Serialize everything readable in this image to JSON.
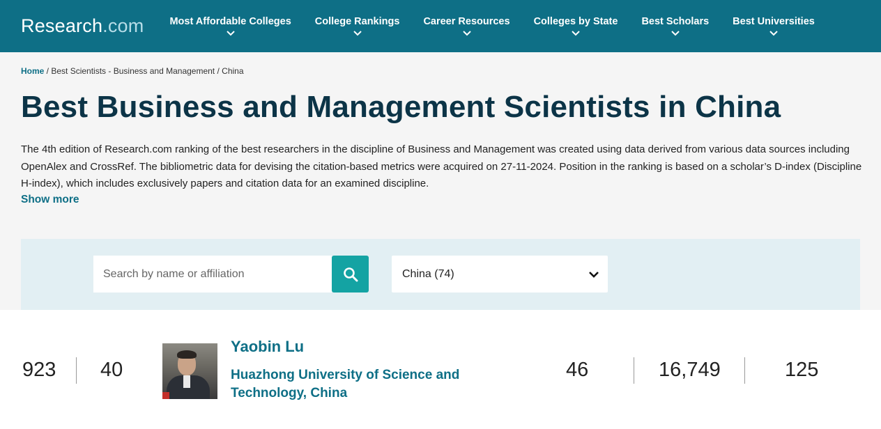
{
  "header": {
    "logo_main": "Research",
    "logo_suffix": ".com",
    "nav": [
      {
        "label": "Most Affordable Colleges"
      },
      {
        "label": "College Rankings"
      },
      {
        "label": "Career Resources"
      },
      {
        "label": "Colleges by State"
      },
      {
        "label": "Best Scholars"
      },
      {
        "label": "Best Universities"
      }
    ]
  },
  "breadcrumb": {
    "home": "Home",
    "sep1": " / ",
    "item1": "Best Scientists - Business and Management",
    "sep2": "  / ",
    "item2": "China"
  },
  "page": {
    "title": "Best Business and Management Scientists in China",
    "description": "The 4th edition of Research.com ranking of the best researchers in the discipline of Business and Management was created using data derived from various data sources including OpenAlex and CrossRef. The bibliometric data for devising the citation-based metrics were acquired on 27-11-2024. Position in the ranking is based on a scholar’s D-index (Discipline H-index), which includes exclusively papers and citation data for an examined discipline.",
    "show_more": "Show more"
  },
  "filters": {
    "search_placeholder": "Search by name or affiliation",
    "search_value": "",
    "country_selected": "China (74)"
  },
  "icons": {
    "search": "search-icon",
    "chevron": "chevron-down-icon"
  },
  "colors": {
    "header_bg": "#0e6f86",
    "accent": "#0e6f86",
    "search_button": "#14a3a3",
    "filter_bg": "#e2eff3"
  },
  "results": [
    {
      "world_rank": "923",
      "national_rank": "40",
      "name": "Yaobin Lu",
      "affiliation": "Huazhong University of Science and Technology, China",
      "d_index": "46",
      "citations": "16,749",
      "publications": "125"
    }
  ]
}
